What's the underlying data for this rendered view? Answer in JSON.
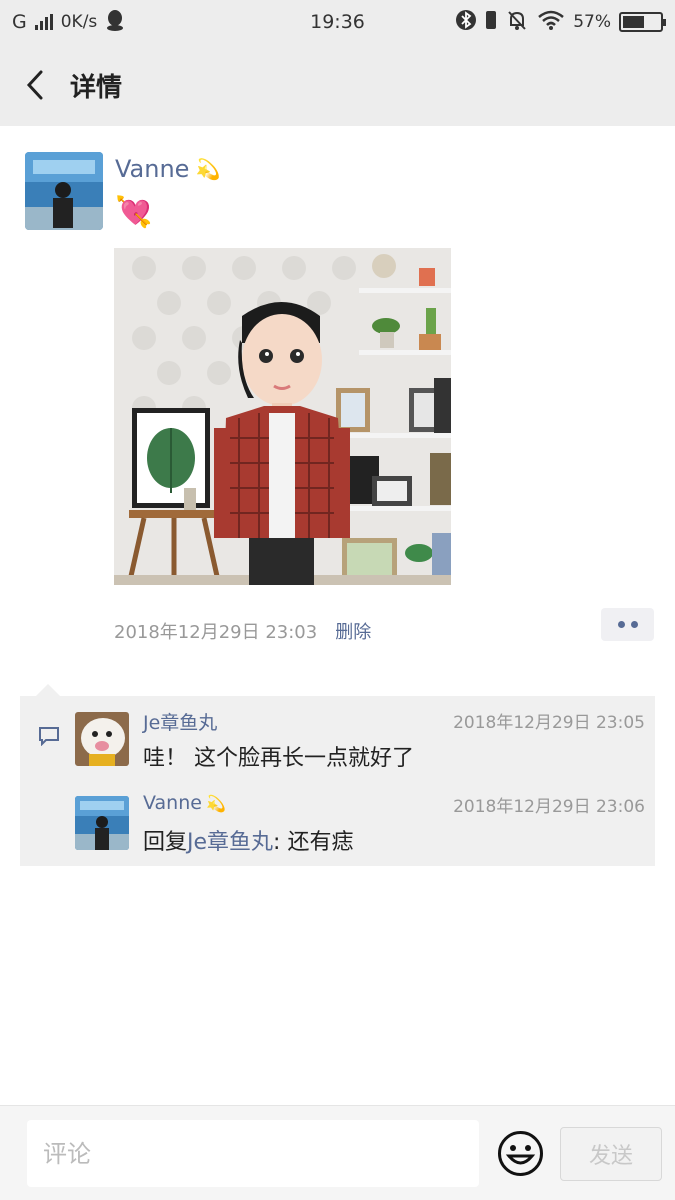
{
  "status_bar": {
    "carrier": "G",
    "net_speed": "0K/s",
    "time": "19:36",
    "battery_text": "57%",
    "battery_level": 0.57
  },
  "nav": {
    "title": "详情"
  },
  "post": {
    "author": "Vanne",
    "author_emoji": "💫",
    "text": "💘",
    "timestamp": "2018年12月29日 23:03",
    "delete_label": "删除"
  },
  "comments": [
    {
      "name": "Je章鱼丸",
      "time": "2018年12月29日 23:05",
      "text": "哇！ 这个脸再长一点就好了"
    },
    {
      "name": "Vanne",
      "name_emoji": "💫",
      "time": "2018年12月29日 23:06",
      "reply_prefix": "回复",
      "reply_to": "Je章鱼丸",
      "reply_sep": ": ",
      "text": "还有痣"
    }
  ],
  "input_bar": {
    "placeholder": "评论",
    "send_label": "发送"
  },
  "colors": {
    "link": "#576b95",
    "bar_bg": "#ededed",
    "comment_bg": "#f0f0f0"
  }
}
